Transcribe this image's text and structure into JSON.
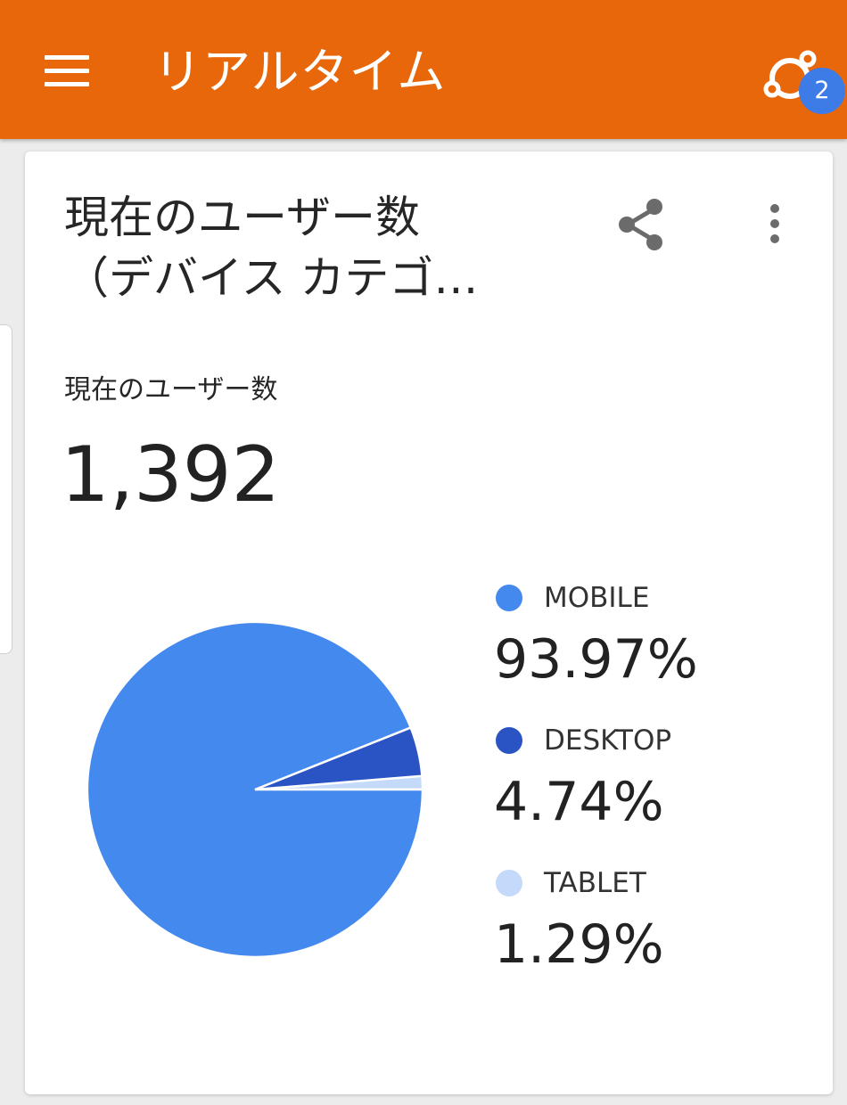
{
  "app_bar": {
    "title": "リアルタイム",
    "badge_count": "2",
    "color": "#e8670a"
  },
  "card": {
    "title_line1": "現在のユーザー数",
    "title_line2": "（デバイス カテゴ…",
    "metric_label": "現在のユーザー数",
    "metric_value": "1,392",
    "icons": [
      "share-icon",
      "more-vert-icon"
    ]
  },
  "chart_data": {
    "type": "pie",
    "categories": [
      "MOBILE",
      "DESKTOP",
      "TABLET"
    ],
    "values": [
      93.97,
      4.74,
      1.29
    ],
    "labels": [
      "93.97%",
      "4.74%",
      "1.29%"
    ],
    "colors": [
      "#4489ee",
      "#2a54c4",
      "#c5dafa"
    ]
  }
}
